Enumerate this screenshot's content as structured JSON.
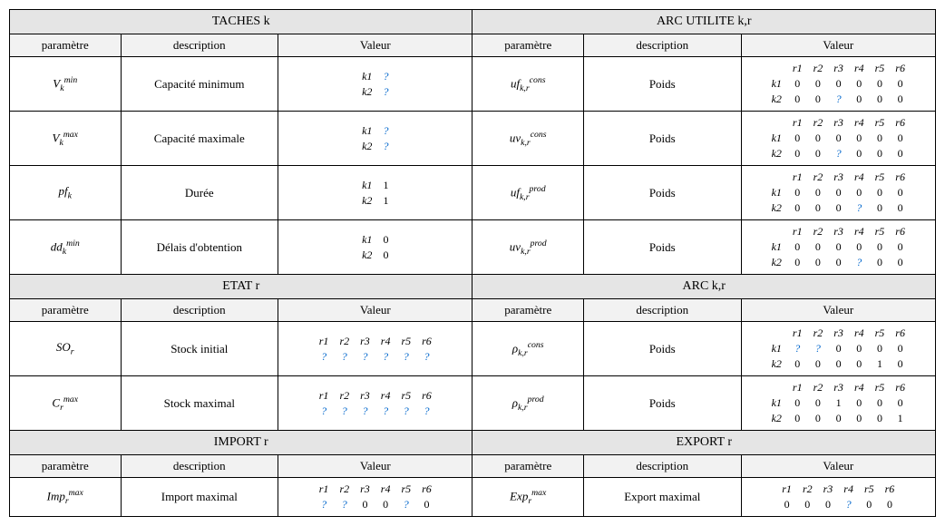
{
  "headers": {
    "param": "paramètre",
    "desc": "description",
    "val": "Valeur"
  },
  "sections": {
    "taches": "TACHES k",
    "arc_util": "ARC UTILITE k,r",
    "etat": "ETAT r",
    "arc_kr": "ARC k,r",
    "import": "IMPORT r",
    "export": "EXPORT r"
  },
  "labels": {
    "cap_min": "Capacité minimum",
    "cap_max": "Capacité maximale",
    "duree": "Durée",
    "delais": "Délais d'obtention",
    "poids": "Poids",
    "stock_init": "Stock initial",
    "stock_max": "Stock maximal",
    "imp_max": "Import maximal",
    "exp_max": "Export maximal"
  },
  "r_cols": [
    "r1",
    "r2",
    "r3",
    "r4",
    "r5",
    "r6"
  ],
  "k_rows": [
    "k1",
    "k2"
  ],
  "chart_data": {
    "type": "table",
    "taches_k": {
      "V_min_k": {
        "k1": "?",
        "k2": "?"
      },
      "V_max_k": {
        "k1": "?",
        "k2": "?"
      },
      "pf_k": {
        "k1": 1,
        "k2": 1
      },
      "dd_min_k": {
        "k1": 0,
        "k2": 0
      }
    },
    "arc_utilite_kr": {
      "uf_cons_kr": {
        "k1": [
          0,
          0,
          0,
          0,
          0,
          0
        ],
        "k2": [
          0,
          0,
          "?",
          0,
          0,
          0
        ]
      },
      "uv_cons_kr": {
        "k1": [
          0,
          0,
          0,
          0,
          0,
          0
        ],
        "k2": [
          0,
          0,
          "?",
          0,
          0,
          0
        ]
      },
      "uf_prod_kr": {
        "k1": [
          0,
          0,
          0,
          0,
          0,
          0
        ],
        "k2": [
          0,
          0,
          0,
          "?",
          0,
          0
        ]
      },
      "uv_prod_kr": {
        "k1": [
          0,
          0,
          0,
          0,
          0,
          0
        ],
        "k2": [
          0,
          0,
          0,
          "?",
          0,
          0
        ]
      }
    },
    "etat_r": {
      "SO_r": [
        "?",
        "?",
        "?",
        "?",
        "?",
        "?"
      ],
      "C_max_r": [
        "?",
        "?",
        "?",
        "?",
        "?",
        "?"
      ]
    },
    "arc_kr": {
      "rho_cons_kr": {
        "k1": [
          "?",
          "?",
          0,
          0,
          0,
          0
        ],
        "k2": [
          0,
          0,
          0,
          0,
          1,
          0
        ]
      },
      "rho_prod_kr": {
        "k1": [
          0,
          0,
          1,
          0,
          0,
          0
        ],
        "k2": [
          0,
          0,
          0,
          0,
          0,
          1
        ]
      }
    },
    "import_r": {
      "Imp_max_r": [
        "?",
        "?",
        0,
        0,
        "?",
        0
      ]
    },
    "export_r": {
      "Exp_max_r": [
        0,
        0,
        0,
        "?",
        0,
        0
      ]
    }
  }
}
